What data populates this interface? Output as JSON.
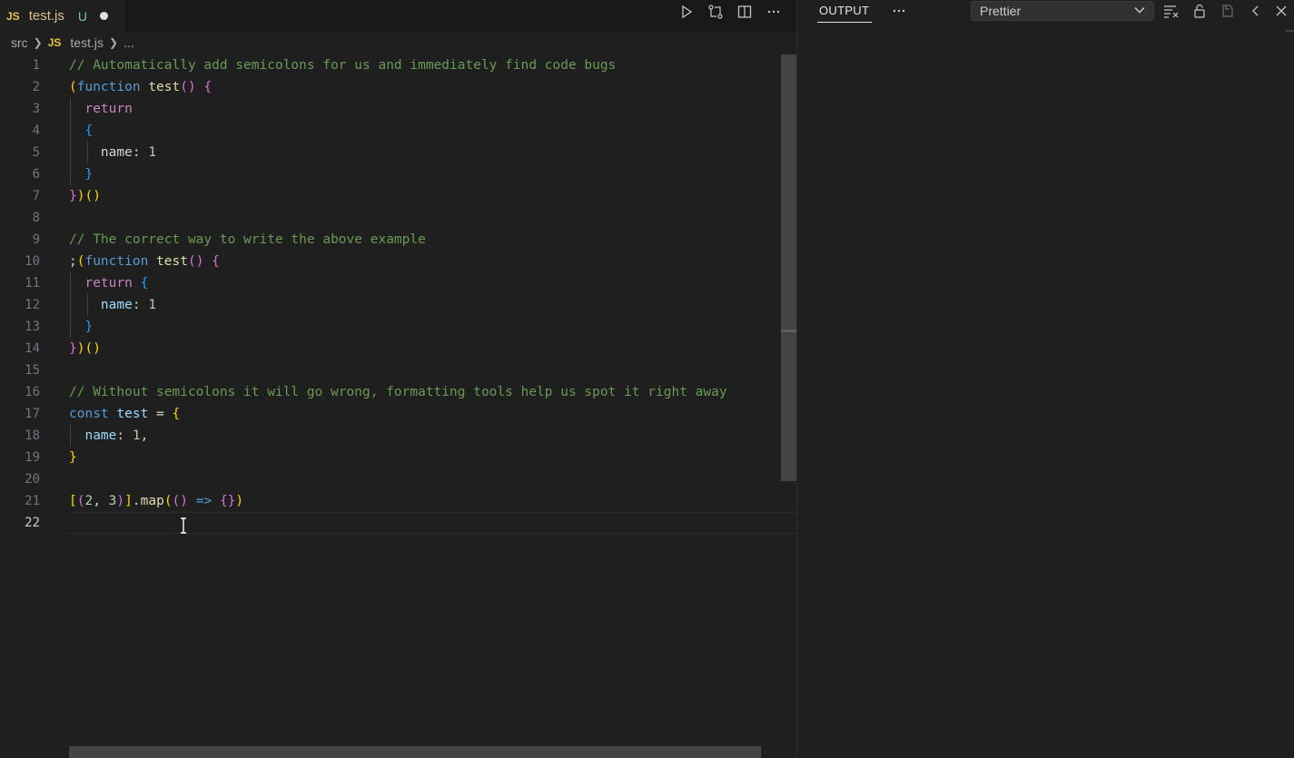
{
  "tab": {
    "lang": "JS",
    "filename": "test.js",
    "badge": "U"
  },
  "breadcrumb": {
    "folder": "src",
    "lang": "JS",
    "file": "test.js",
    "more": "..."
  },
  "editor": {
    "active_line": 22,
    "line_numbers": [
      "1",
      "2",
      "3",
      "4",
      "5",
      "6",
      "7",
      "8",
      "9",
      "10",
      "11",
      "12",
      "13",
      "14",
      "15",
      "16",
      "17",
      "18",
      "19",
      "20",
      "21",
      "22"
    ]
  },
  "panel": {
    "tab_label": "OUTPUT",
    "channel_value": "Prettier"
  },
  "icons": {
    "run": "play-icon",
    "compare": "git-compare-icon",
    "split": "split-editor-icon",
    "more": "more-icon",
    "panel_more": "more-icon",
    "clear": "clear-output-icon",
    "lock": "lock-icon",
    "copy": "open-output-icon",
    "prev": "chevron-left-icon",
    "close": "close-icon"
  },
  "colors": {
    "accent_js": "#e8c73d",
    "modified": "#e2c08d",
    "untracked": "#73c991",
    "comment": "#6a9955",
    "keyword": "#569cd6"
  }
}
